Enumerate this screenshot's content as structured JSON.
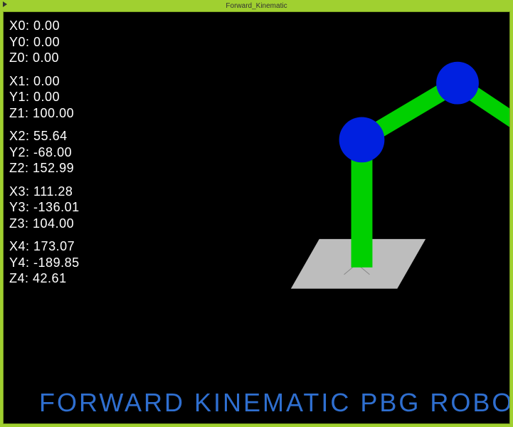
{
  "window": {
    "title": "Forward_Kinematic"
  },
  "joints": [
    {
      "X": "0.00",
      "Y": "0.00",
      "Z": "0.00"
    },
    {
      "X": "0.00",
      "Y": "0.00",
      "Z": "100.00"
    },
    {
      "X": "55.64",
      "Y": "-68.00",
      "Z": "152.99"
    },
    {
      "X": "111.28",
      "Y": "-136.01",
      "Z": "104.00"
    },
    {
      "X": "173.07",
      "Y": "-189.85",
      "Z": "42.61"
    }
  ],
  "labels": {
    "X": "X",
    "Y": "Y",
    "Z": "Z",
    "sep": ": "
  },
  "banner": "FORWARD KINEMATIC PBG ROBOT",
  "colors": {
    "link": "#00d000",
    "joint": "#0020e0",
    "base": "#bdbdbd",
    "banner": "#2f6fd0"
  }
}
